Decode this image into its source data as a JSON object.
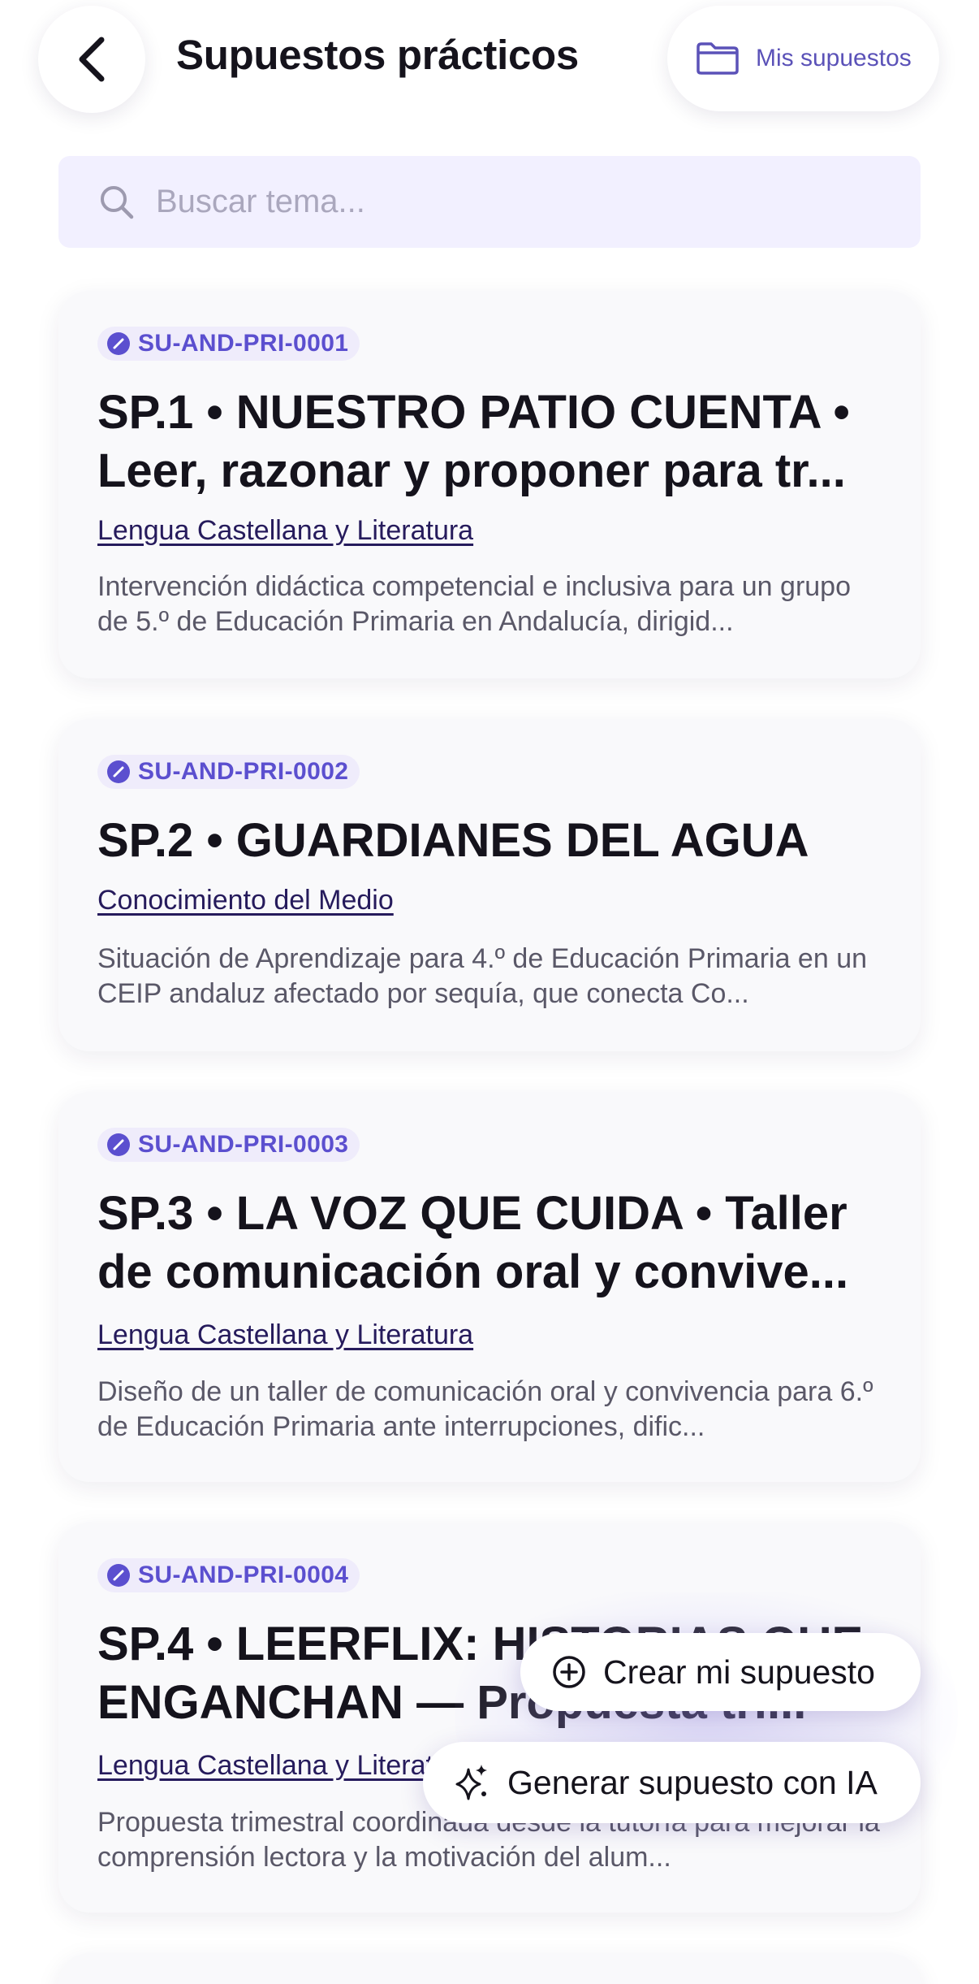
{
  "header": {
    "title": "Supuestos prácticos",
    "mis_supuestos_label": "Mis supuestos"
  },
  "search": {
    "placeholder": "Buscar tema..."
  },
  "cards": [
    {
      "code": "SU-AND-PRI-0001",
      "title": "SP.1 • NUESTRO PATIO CUENTA • Leer, razonar y proponer para tr...",
      "subject": "Lengua Castellana y Literatura",
      "description": "Intervención didáctica competencial e inclusiva para un grupo de 5.º de Educación Primaria en Andalucía, dirigid..."
    },
    {
      "code": "SU-AND-PRI-0002",
      "title": "SP.2 • GUARDIANES DEL AGUA",
      "subject": "Conocimiento del Medio",
      "description": "Situación de Aprendizaje para 4.º de Educación Primaria en un CEIP andaluz afectado por sequía, que conecta Co..."
    },
    {
      "code": "SU-AND-PRI-0003",
      "title": "SP.3 • LA VOZ QUE CUIDA • Taller de comunicación oral y convive...",
      "subject": "Lengua Castellana y Literatura",
      "description": "Diseño de un taller de comunicación oral y convivencia para 6.º de Educación Primaria ante interrupciones, dific..."
    },
    {
      "code": "SU-AND-PRI-0004",
      "title": "SP.4 • LEERFLIX: HISTORIAS QUE ENGANCHAN — Propuesta tri...",
      "subject": "Lengua Castellana y Literatura",
      "description": "Propuesta trimestral coordinada desde la tutoría para mejorar la comprensión lectora y la motivación del alum..."
    }
  ],
  "actions": {
    "create_label": "Crear mi supuesto",
    "generate_label": "Generar supuesto con IA"
  },
  "colors": {
    "accent": "#5b4fcf",
    "search_bg": "#f2f0ff",
    "card_bg": "#f9f9fb"
  },
  "icons": {
    "back": "chevron-left-icon",
    "folder": "folder-icon",
    "search": "search-icon",
    "badge": "pencil-icon",
    "create": "plus-circle-icon",
    "generate": "sparkles-icon"
  }
}
